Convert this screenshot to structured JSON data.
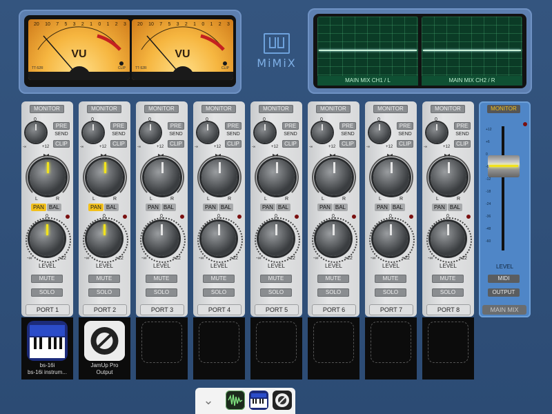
{
  "app": {
    "name": "MiMiX"
  },
  "vu_meters": [
    {
      "label": "VU",
      "model": "TT-52R",
      "clip": "CLIP",
      "scale": [
        "20",
        "10",
        "7",
        "5",
        "3",
        "2",
        "1",
        "0",
        "1",
        "2",
        "3"
      ]
    },
    {
      "label": "VU",
      "model": "TT-52R",
      "clip": "CLIP",
      "scale": [
        "20",
        "10",
        "7",
        "5",
        "3",
        "2",
        "1",
        "0",
        "1",
        "2",
        "3"
      ]
    }
  ],
  "scopes": [
    {
      "label": "MAIN MIX CH1 / L"
    },
    {
      "label": "MAIN MIX CH2 / R"
    }
  ],
  "strip_labels": {
    "monitor": "MONITOR",
    "pre": "PRE",
    "send": "SEND",
    "clip": "CLIP",
    "send_zero": "0",
    "send_min": "-∞",
    "send_max": "+12",
    "left": "L",
    "right": "R",
    "pan": "PAN",
    "bal": "BAL",
    "level_zero": "0",
    "level_min": "-∞",
    "level_max": "+12",
    "level": "LEVEL",
    "mute": "MUTE",
    "solo": "SOLO"
  },
  "channels": [
    {
      "port": "PORT 1",
      "pan_active": true,
      "active": true
    },
    {
      "port": "PORT 2",
      "pan_active": true,
      "active": true
    },
    {
      "port": "PORT 3",
      "pan_active": false,
      "active": false
    },
    {
      "port": "PORT 4",
      "pan_active": false,
      "active": false
    },
    {
      "port": "PORT 5",
      "pan_active": false,
      "active": false
    },
    {
      "port": "PORT 6",
      "pan_active": false,
      "active": false
    },
    {
      "port": "PORT 7",
      "pan_active": false,
      "active": false
    },
    {
      "port": "PORT 8",
      "pan_active": false,
      "active": false
    }
  ],
  "slots": [
    {
      "caption1": "bs-16i",
      "caption2": "bs-16i instrum...",
      "icon": "keyboard-synth-icon"
    },
    {
      "caption1": "JamUp Pro",
      "caption2": "Output",
      "icon": "jamup-pro-icon"
    },
    {
      "caption1": "",
      "caption2": "",
      "icon": "empty-slot"
    },
    {
      "caption1": "",
      "caption2": "",
      "icon": "empty-slot"
    },
    {
      "caption1": "",
      "caption2": "",
      "icon": "empty-slot"
    },
    {
      "caption1": "",
      "caption2": "",
      "icon": "empty-slot"
    },
    {
      "caption1": "",
      "caption2": "",
      "icon": "empty-slot"
    },
    {
      "caption1": "",
      "caption2": "",
      "icon": "empty-slot"
    }
  ],
  "master": {
    "monitor": "MONITOR",
    "scale": [
      "+12",
      "+6",
      "0",
      "-6",
      "-12",
      "-18",
      "-24",
      "-36",
      "-48",
      "-60"
    ],
    "level": "LEVEL",
    "midi": "MIDI",
    "output": "OUTPUT",
    "main_mix": "MAIN MIX"
  },
  "dock": {
    "icons": [
      "chevron-down-icon",
      "audio-wave-app-icon",
      "keyboard-synth-icon",
      "jamup-pro-icon"
    ]
  },
  "colors": {
    "accent_yellow": "#f2c01c",
    "panel_blue": "#4f86c7",
    "scope_green": "#0b3b26"
  }
}
